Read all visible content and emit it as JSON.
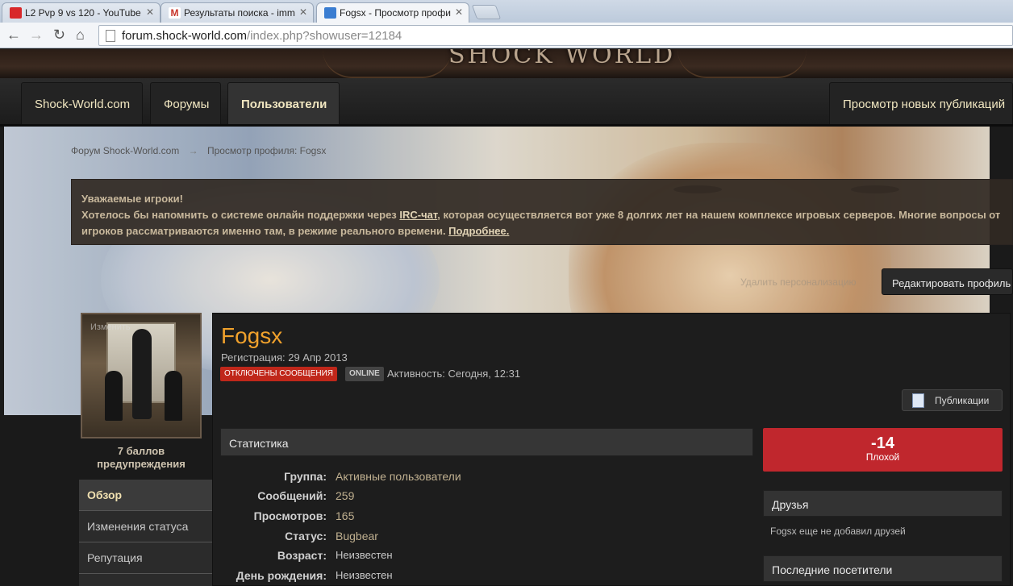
{
  "browser": {
    "tabs": [
      {
        "title": "L2 Pvp 9 vs 120 - YouTube",
        "favicon_color": "#d8282a"
      },
      {
        "title": "Результаты поиска - imm",
        "favicon_color": "#c8352b"
      },
      {
        "title": "Fogsx - Просмотр профи",
        "favicon_color": "#3a7dd1"
      }
    ],
    "url_host": "forum.shock-world.com",
    "url_path": "/index.php?showuser=12184"
  },
  "site": {
    "logo": "SHOCK WORLD",
    "nav": [
      "Shock-World.com",
      "Форумы",
      "Пользователи"
    ],
    "nav_right": "Просмотр новых публикаций"
  },
  "breadcrumb": [
    "Форум Shock-World.com",
    "→",
    "Просмотр профиля: Fogsx"
  ],
  "notice": {
    "title": "Уважаемые игроки!",
    "text_before": "Хотелось бы напомнить о системе онлайн поддержки через ",
    "link1": "IRC-чат",
    "text_mid": ", которая осуществляется вот уже 8 долгих лет на нашем комплексе игровых серверов. Многие вопросы от игроков рассматриваются именно там, в режиме реального времени. ",
    "link2": "Подробнее."
  },
  "profile_actions": {
    "ghost": "Удалить персонализацию",
    "edit": "Редактировать профиль"
  },
  "avatar": {
    "change_label": "Изменить"
  },
  "warnings": "7 баллов предупреждения",
  "side_menu": [
    "Обзор",
    "Изменения статуса",
    "Репутация"
  ],
  "user": {
    "name": "Fogsx",
    "registered": "Регистрация: 29 Апр 2013",
    "badge_messages": "ОТКЛЮЧЕНЫ СООБЩЕНИЯ",
    "badge_status": "ONLINE",
    "activity": "Активность: Сегодня, 12:31"
  },
  "publications_button": "Публикации",
  "stats": {
    "title": "Статистика",
    "rows": [
      {
        "k": "Группа:",
        "v": "Активные пользователи"
      },
      {
        "k": "Сообщений:",
        "v": "259"
      },
      {
        "k": "Просмотров:",
        "v": "165"
      },
      {
        "k": "Статус:",
        "v": "Bugbear"
      },
      {
        "k": "Возраст:",
        "v": "Неизвестен"
      },
      {
        "k": "День рождения:",
        "v": "Неизвестен"
      }
    ]
  },
  "reputation": {
    "value": "-14",
    "label": "Плохой"
  },
  "friends": {
    "title": "Друзья",
    "text": "Fogsx еще не добавил друзей"
  },
  "visitors": {
    "title": "Последние посетители"
  }
}
